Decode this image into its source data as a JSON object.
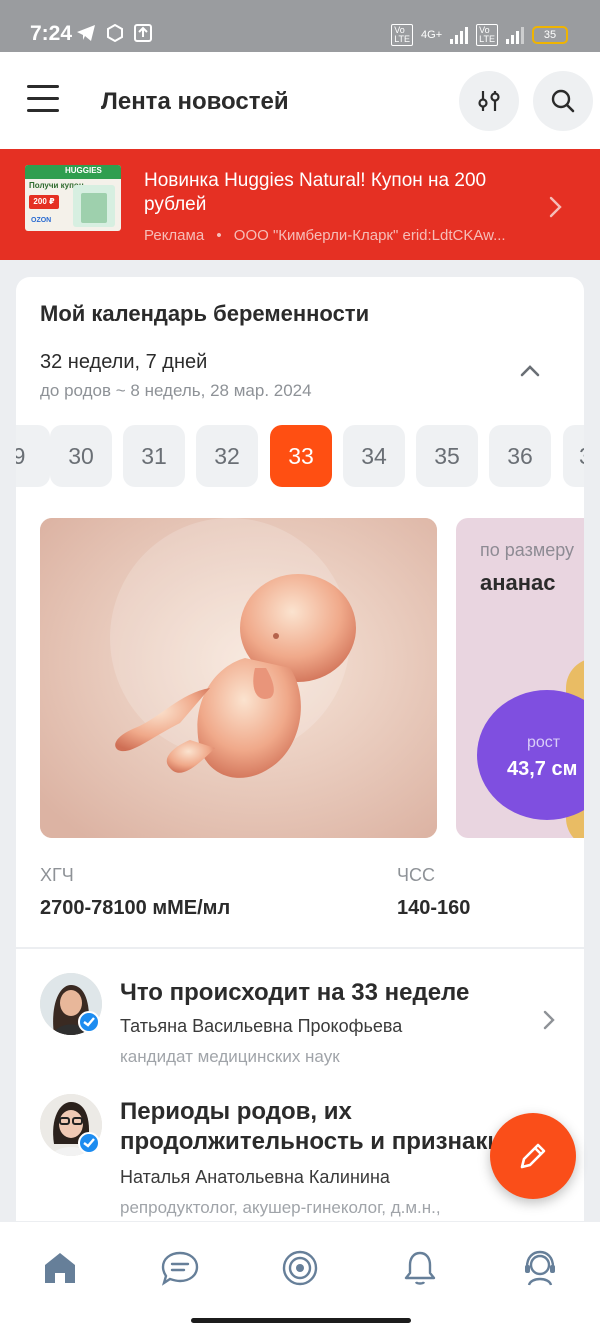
{
  "status_bar": {
    "time": "7:24",
    "battery": "35",
    "network": "4G+"
  },
  "header": {
    "title": "Лента новостей"
  },
  "ad": {
    "title": "Новинка Huggies Natural! Купон на 200 рублей",
    "label": "Реклама",
    "separator": "•",
    "advertiser": "ООО \"Кимберли-Кларк\" erid:LdtCKAw...",
    "thumb_brand": "HUGGIES",
    "thumb_text": "Получи купон",
    "thumb_price": "200 ₽",
    "thumb_store": "OZON"
  },
  "calendar": {
    "title": "Мой календарь беременности",
    "weeks_label": "32 недели, 7 дней",
    "due_label": "до родов ~ 8 недель, 28 мар. 2024",
    "weeks": [
      "9",
      "30",
      "31",
      "32",
      "33",
      "34",
      "35",
      "36",
      "3"
    ],
    "active_week": "33",
    "size_label": "по размеру",
    "size_value": "ананас",
    "height_label": "рост",
    "height_value": "43,7 см",
    "stats": [
      {
        "label": "ХГЧ",
        "value": "2700-78100 мМЕ/мл"
      },
      {
        "label": "ЧСС",
        "value": "140-160"
      }
    ]
  },
  "articles": [
    {
      "title": "Что происходит на 33 неделе",
      "author": "Татьяна Васильевна Прокофьева",
      "role": "кандидат медицинских наук"
    },
    {
      "title_line1": "Периоды родов, их",
      "title_line2": "продолжительность и признаки",
      "author": "Наталья Анатольевна Калинина",
      "role": "репродуктолог, акушер-гинеколог, д.м.н.,"
    }
  ],
  "colors": {
    "accent": "#ff4f12",
    "ad_background": "#e53023",
    "height_circle": "#7f4fe0",
    "verified": "#1d8cf0"
  },
  "bottom_nav": [
    "home-icon",
    "chat-icon",
    "target-icon",
    "bell-icon",
    "support-icon"
  ]
}
